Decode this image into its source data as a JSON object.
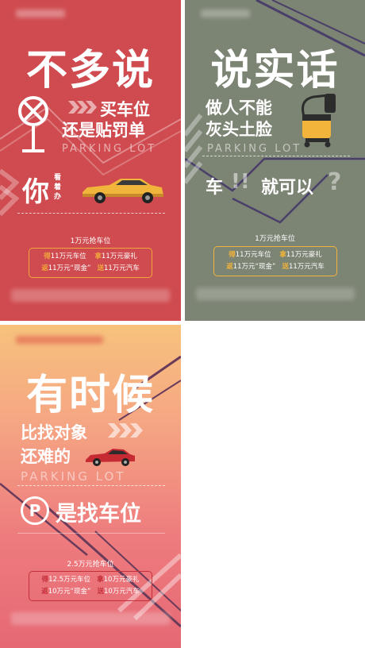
{
  "posters": [
    {
      "headline": "不多说",
      "line1": "买车位",
      "line2": "还是贴罚单",
      "english": "PARKING LOT",
      "tail_big": "你",
      "tail_small_1": "看",
      "tail_small_2": "着",
      "tail_small_3": "办",
      "price_tag": "1万元抢车位",
      "offers": [
        {
          "k": "得",
          "t": "11万元车位"
        },
        {
          "k": "拿",
          "t": "11万元豪礼"
        },
        {
          "k": "返",
          "t": "11万元“现金”"
        },
        {
          "k": "送",
          "t": "11万元汽车"
        }
      ],
      "icons": [
        "no-parking-sign-icon",
        "chevron-arrows-icon",
        "yellow-car-icon"
      ],
      "colors": {
        "background": "#cf4b4f",
        "accent": "#f0a63c",
        "offer_border": "#f0a63c"
      }
    },
    {
      "headline": "说实话",
      "line1": "做人不能",
      "line2": "灰头土脸",
      "english": "PARKING LOT",
      "tail_1": "车",
      "tail_marks": "!!",
      "tail_2": "就可以",
      "tail_q": "?",
      "price_tag": "1万元抢车位",
      "offers": [
        {
          "k": "得",
          "t": "11万元车位"
        },
        {
          "k": "拿",
          "t": "11万元豪礼"
        },
        {
          "k": "返",
          "t": "11万元“现金”"
        },
        {
          "k": "送",
          "t": "11万元汽车"
        }
      ],
      "icons": [
        "vacuum-cleaner-icon"
      ],
      "colors": {
        "background": "#7c8474",
        "accent": "#f2b43a",
        "offer_border": "#f2b43a"
      }
    },
    {
      "headline": "有时候",
      "line1": "比找对象",
      "line2": "还难的",
      "english": "PARKING LOT",
      "tail": "是找车位",
      "parking_symbol": "P",
      "price_tag": "2.5万元抢车位",
      "offers": [
        {
          "k": "得",
          "t": "12.5万元车位"
        },
        {
          "k": "拿",
          "t": "10万元豪礼"
        },
        {
          "k": "返",
          "t": "10万元“现金”"
        },
        {
          "k": "送",
          "t": "10万元汽车"
        }
      ],
      "icons": [
        "parking-p-icon",
        "red-sports-car-icon",
        "chevron-arrows-icon"
      ],
      "colors": {
        "background_top": "#f7c27c",
        "background_bottom": "#e56874",
        "accent": "#c4303a",
        "offer_border": "#c4303a"
      }
    }
  ]
}
